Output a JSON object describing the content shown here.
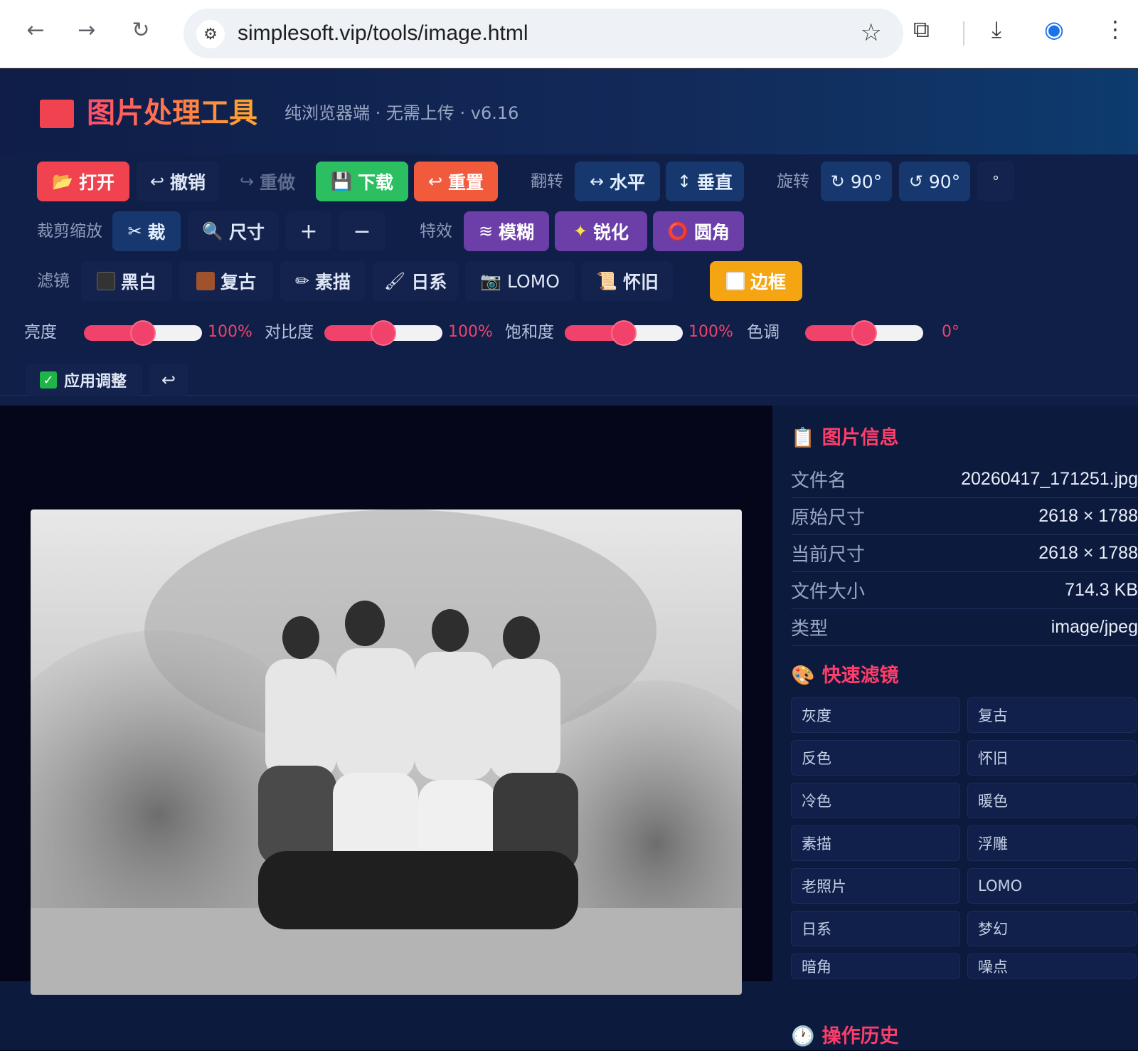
{
  "browser": {
    "url": "simplesoft.vip/tools/image.html",
    "icons": [
      "back-icon",
      "forward-icon",
      "reload-icon",
      "tune-icon",
      "star-icon",
      "extensions-icon",
      "download-icon",
      "profile-icon",
      "menu-icon"
    ]
  },
  "header": {
    "title": "图片处理工具",
    "subtitle": "纯浏览器端 · 无需上传 · v6.16"
  },
  "toolbar": {
    "row1": {
      "open": "打开",
      "undo": "撤销",
      "redo": "重做",
      "download": "下载",
      "reset": "重置",
      "flip_label": "翻转",
      "flip_h": "水平",
      "flip_v": "垂直",
      "rotate_label": "旋转",
      "rotate_cw": "90°",
      "rotate_ccw": "90°",
      "rotate_custom": "°"
    },
    "row2": {
      "crop_label": "裁剪缩放",
      "crop": "裁",
      "size": "尺寸",
      "zoom_in": "+",
      "zoom_out": "−",
      "effects_label": "特效",
      "blur": "模糊",
      "sharpen": "锐化",
      "round": "圆角"
    },
    "row3": {
      "filter_label": "滤镜",
      "bw": "黑白",
      "retro": "复古",
      "sketch": "素描",
      "japanese": "日系",
      "lomo": "LOMO",
      "nostalgic": "怀旧",
      "border": "边框"
    }
  },
  "adjust": {
    "brightness": {
      "label": "亮度",
      "value": "100%",
      "level": 0.5
    },
    "contrast": {
      "label": "对比度",
      "value": "100%",
      "level": 0.5
    },
    "saturation": {
      "label": "饱和度",
      "value": "100%",
      "level": 0.5
    },
    "hue": {
      "label": "色调",
      "value": "0°",
      "level": 0.5
    },
    "apply": "应用调整",
    "apply_checked": true
  },
  "info": {
    "title": "图片信息",
    "rows": [
      {
        "k": "文件名",
        "v": "20260417_171251.jpg"
      },
      {
        "k": "原始尺寸",
        "v": "2618 × 1788"
      },
      {
        "k": "当前尺寸",
        "v": "2618 × 1788"
      },
      {
        "k": "文件大小",
        "v": "714.3 KB"
      },
      {
        "k": "类型",
        "v": "image/jpeg"
      }
    ]
  },
  "quick": {
    "title": "快速滤镜",
    "items": [
      "灰度",
      "复古",
      "反色",
      "怀旧",
      "冷色",
      "暖色",
      "素描",
      "浮雕",
      "老照片",
      "LOMO",
      "日系",
      "梦幻",
      "暗角",
      "噪点"
    ]
  },
  "history": {
    "title": "操作历史"
  },
  "colors": {
    "accent": "#f0424f",
    "green": "#2bbf62",
    "orange": "#f25a3c",
    "blue": "#16386e",
    "purple": "#6b3ea8",
    "amber": "#f5a511",
    "panel": "#0f1f48"
  }
}
